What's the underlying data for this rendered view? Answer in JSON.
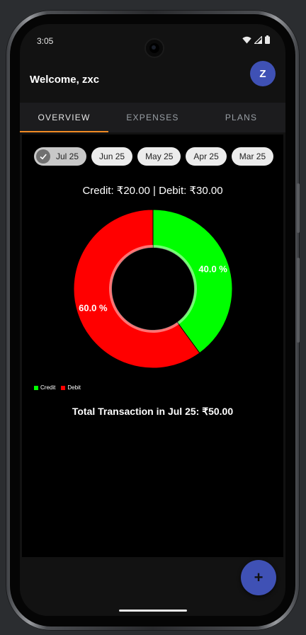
{
  "status_bar": {
    "time": "3:05"
  },
  "header": {
    "welcome": "Welcome, zxc",
    "avatar_letter": "Z"
  },
  "tabs": [
    {
      "label": "OVERVIEW",
      "active": true
    },
    {
      "label": "EXPENSES",
      "active": false
    },
    {
      "label": "PLANS",
      "active": false
    }
  ],
  "month_chips": [
    {
      "label": "Jul 25",
      "selected": true
    },
    {
      "label": "Jun 25",
      "selected": false
    },
    {
      "label": "May 25",
      "selected": false
    },
    {
      "label": "Apr 25",
      "selected": false
    },
    {
      "label": "Mar 25",
      "selected": false
    }
  ],
  "summary": "Credit: ₹20.00 | Debit: ₹30.00",
  "chart_data": {
    "type": "pie",
    "donut": true,
    "categories": [
      "Credit",
      "Debit"
    ],
    "values": [
      40.0,
      60.0
    ],
    "value_labels": [
      "40.0 %",
      "60.0 %"
    ],
    "colors": [
      "#00ff00",
      "#ff0000"
    ],
    "legend": [
      "Credit",
      "Debit"
    ],
    "legend_placement": "bottom-left"
  },
  "total": "Total Transaction in Jul 25: ₹50.00",
  "fab": {
    "label": "+"
  }
}
